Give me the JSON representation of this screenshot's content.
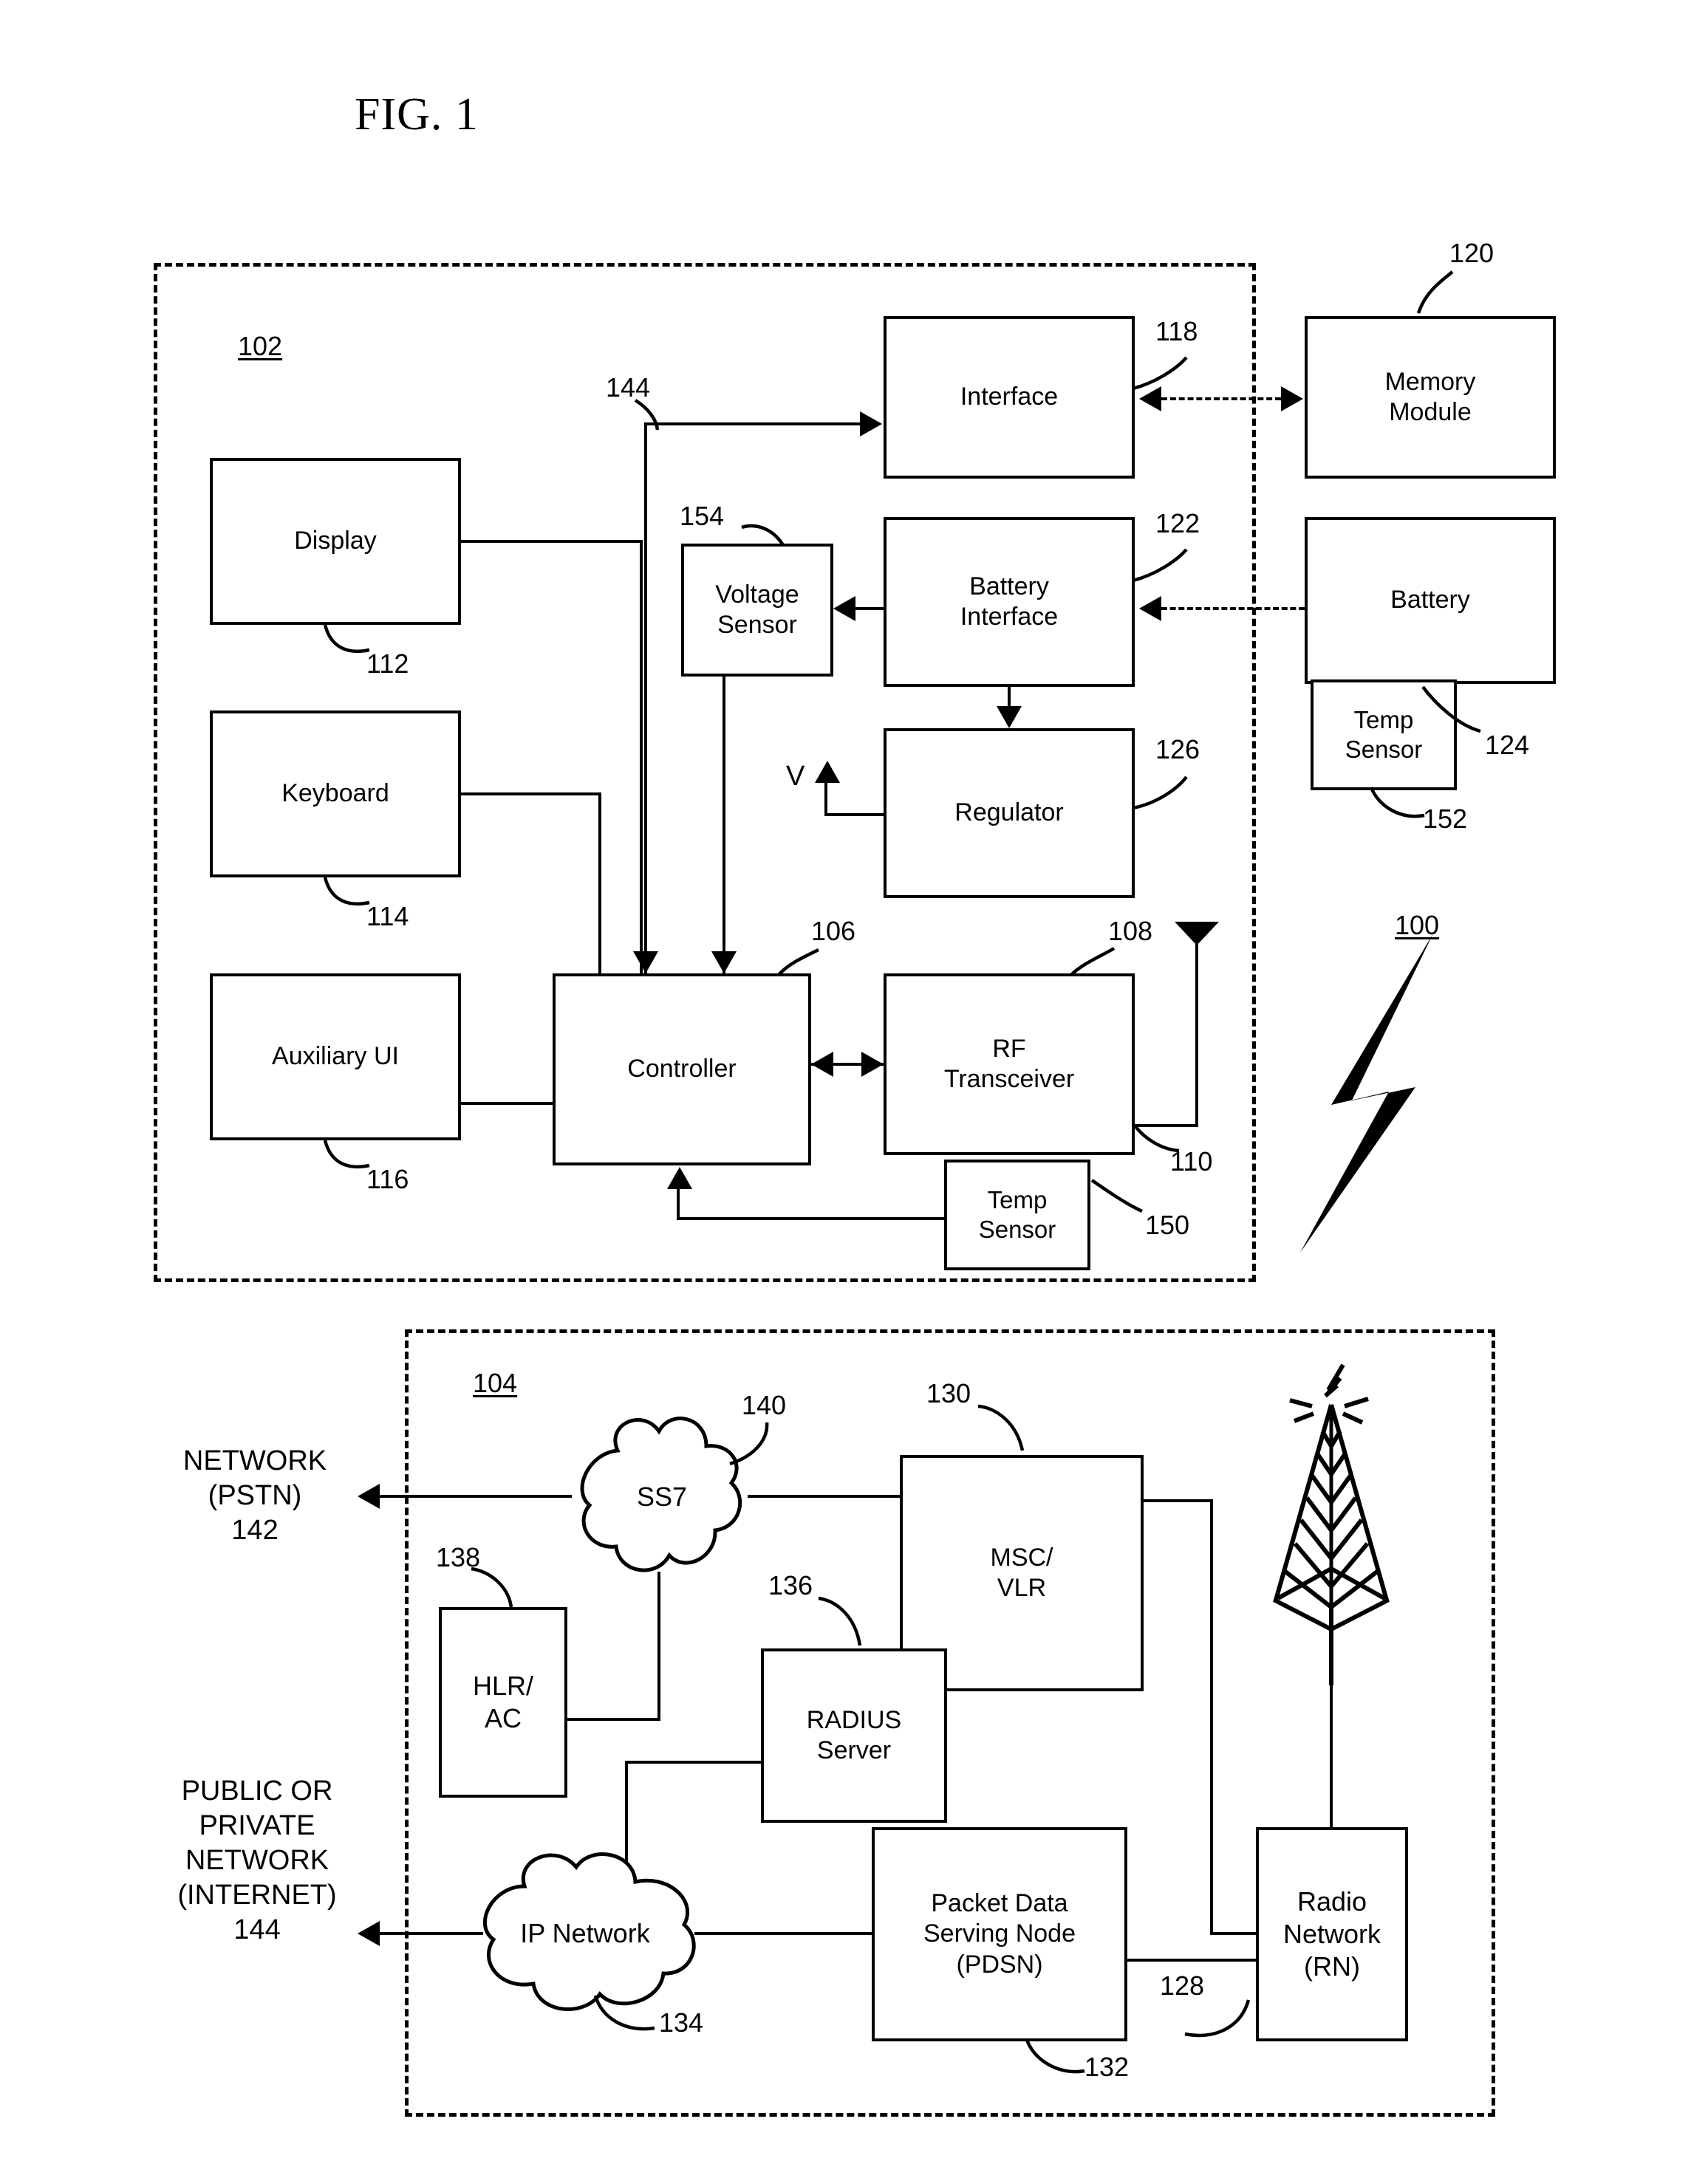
{
  "figure": {
    "title": "FIG. 1",
    "system_ref": "100",
    "device_ref": "102",
    "network_ref": "104"
  },
  "device": {
    "blocks": [
      {
        "id": "display",
        "label": "Display",
        "ref": "112"
      },
      {
        "id": "keyboard",
        "label": "Keyboard",
        "ref": "114"
      },
      {
        "id": "auxiliary-ui",
        "label": "Auxiliary UI",
        "ref": "116"
      },
      {
        "id": "controller",
        "label": "Controller",
        "ref": "106"
      },
      {
        "id": "interface",
        "label": "Interface",
        "ref": "118"
      },
      {
        "id": "voltage-sensor",
        "label": "Voltage\nSensor",
        "ref": "154"
      },
      {
        "id": "battery-interface",
        "label": "Battery\nInterface",
        "ref": "122"
      },
      {
        "id": "regulator",
        "label": "Regulator",
        "ref": "126"
      },
      {
        "id": "rf-transceiver",
        "label": "RF\nTransceiver",
        "ref": "108"
      },
      {
        "id": "temp-sensor-device",
        "label": "Temp\nSensor",
        "ref": "150"
      },
      {
        "id": "memory-module",
        "label": "Memory\nModule",
        "ref": "120"
      },
      {
        "id": "battery",
        "label": "Battery",
        "ref": "124"
      },
      {
        "id": "temp-sensor-batt",
        "label": "Temp\nSensor",
        "ref": "152"
      }
    ],
    "antenna_ref": "110",
    "bus_ref": "144",
    "voltage_symbol": "V"
  },
  "network": {
    "blocks": [
      {
        "id": "msc-vlr",
        "label": "MSC/\nVLR",
        "ref": "130"
      },
      {
        "id": "hlr-ac",
        "label": "HLR/\nAC",
        "ref": "138"
      },
      {
        "id": "radius-server",
        "label": "RADIUS\nServer",
        "ref": "136"
      },
      {
        "id": "pdsn",
        "label": "Packet Data\nServing Node\n(PDSN)",
        "ref": "132"
      },
      {
        "id": "radio-network",
        "label": "Radio\nNetwork\n(RN)",
        "ref": "128"
      }
    ],
    "clouds": [
      {
        "id": "ss7",
        "label": "SS7",
        "ref": "140"
      },
      {
        "id": "ip-network",
        "label": "IP Network",
        "ref": "134"
      }
    ],
    "external": [
      {
        "id": "pstn",
        "label": "NETWORK\n(PSTN)\n142"
      },
      {
        "id": "internet",
        "label": "PUBLIC  OR\nPRIVATE\nNETWORK\n(INTERNET)\n144"
      }
    ]
  }
}
